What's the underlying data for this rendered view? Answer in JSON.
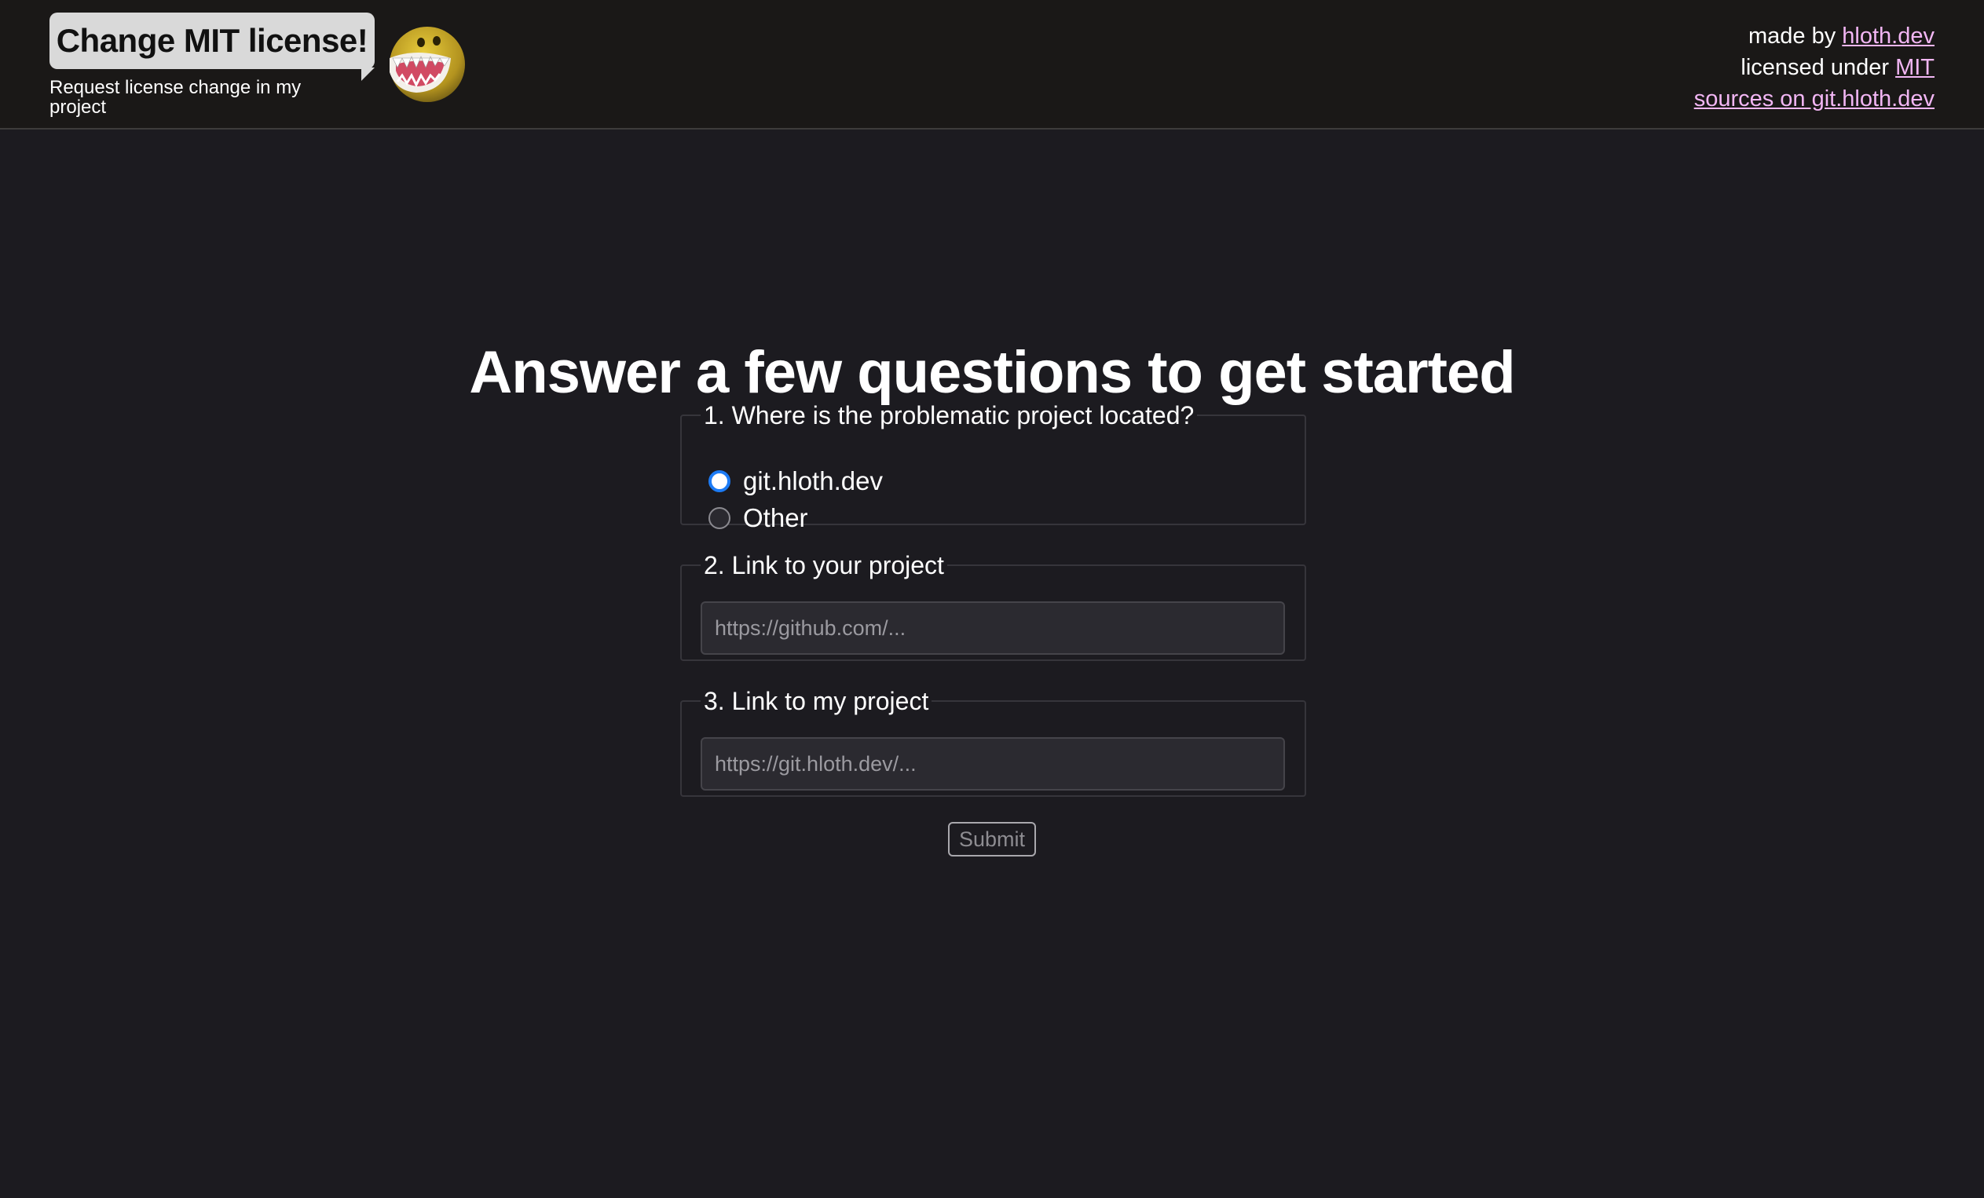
{
  "header": {
    "logo_title": "Change MIT license!",
    "subtitle": "Request license change in my project",
    "mascot_icon": "grinning-monster-icon",
    "credits": {
      "made_by_prefix": "made by ",
      "made_by_link": "hloth.dev",
      "licensed_prefix": "licensed under ",
      "license_link": "MIT",
      "sources_link": "sources on git.hloth.dev"
    }
  },
  "main": {
    "title": "Answer a few questions to get started",
    "question1": {
      "legend": "1. Where is the problematic project located?",
      "options": [
        {
          "label": "git.hloth.dev",
          "checked": true
        },
        {
          "label": "Other",
          "checked": false
        }
      ]
    },
    "question2": {
      "legend": "2. Link to your project",
      "placeholder": "https://github.com/...",
      "value": ""
    },
    "question3": {
      "legend": "3. Link to my project",
      "placeholder": "https://git.hloth.dev/...",
      "value": ""
    },
    "submit_label": "Submit"
  },
  "colors": {
    "background": "#1c1b20",
    "header_background": "#1a1817",
    "link": "#f2b6f4",
    "radio_accent": "#1c7bf5"
  }
}
